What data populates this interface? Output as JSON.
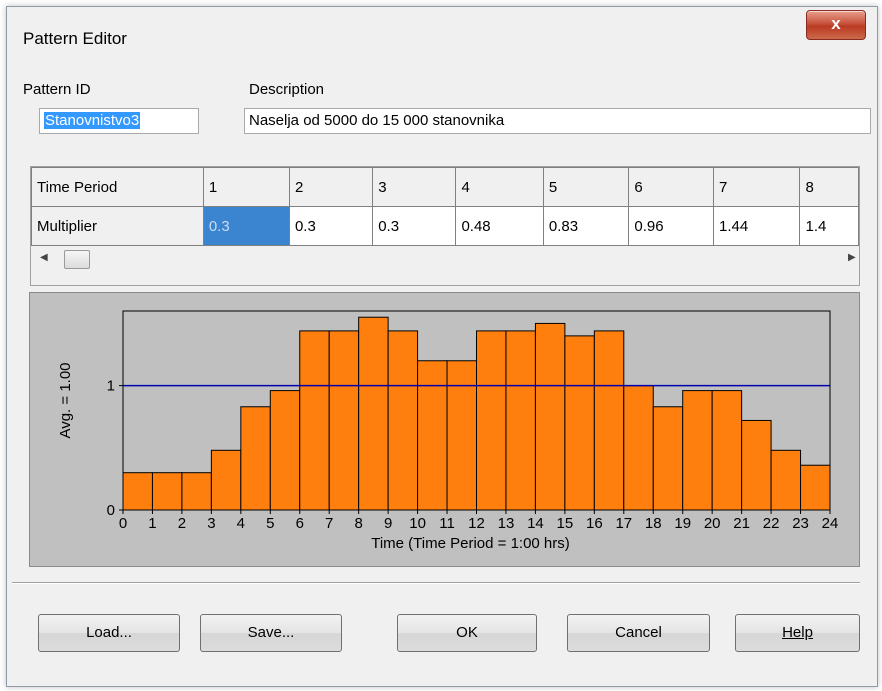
{
  "window": {
    "title": "Pattern Editor",
    "close_label": "x"
  },
  "pattern_id": {
    "label": "Pattern ID",
    "value": "Stanovnistvo3"
  },
  "description": {
    "label": "Description",
    "value": "Naselja od 5000 do 15 000 stanovnika"
  },
  "grid": {
    "row_header_period": "Time Period",
    "row_header_multiplier": "Multiplier",
    "periods": [
      "1",
      "2",
      "3",
      "4",
      "5",
      "6",
      "7",
      "8"
    ],
    "multipliers": [
      "0.3",
      "0.3",
      "0.3",
      "0.48",
      "0.83",
      "0.96",
      "1.44",
      "1.4"
    ]
  },
  "chart_data": {
    "type": "bar",
    "ylabel": "Avg. = 1.00",
    "xlabel": "Time (Time Period = 1:00 hrs)",
    "x_ticks": [
      "0",
      "1",
      "2",
      "3",
      "4",
      "5",
      "6",
      "7",
      "8",
      "9",
      "10",
      "11",
      "12",
      "13",
      "14",
      "15",
      "16",
      "17",
      "18",
      "19",
      "20",
      "21",
      "22",
      "23",
      "24"
    ],
    "y_ticks": [
      "0",
      "1"
    ],
    "values": [
      0.3,
      0.3,
      0.3,
      0.48,
      0.83,
      0.96,
      1.44,
      1.44,
      1.55,
      1.44,
      1.2,
      1.2,
      1.44,
      1.44,
      1.5,
      1.4,
      1.44,
      1.0,
      0.83,
      0.96,
      0.96,
      0.72,
      0.48,
      0.36
    ],
    "average": 1.0,
    "ylim": [
      0,
      1.6
    ],
    "bar_color": "#ff7f0e",
    "avg_line_color": "#0000aa",
    "background_color": "#c0c0c0"
  },
  "buttons": {
    "load": "Load...",
    "save": "Save...",
    "ok": "OK",
    "cancel": "Cancel",
    "help": "Help"
  }
}
